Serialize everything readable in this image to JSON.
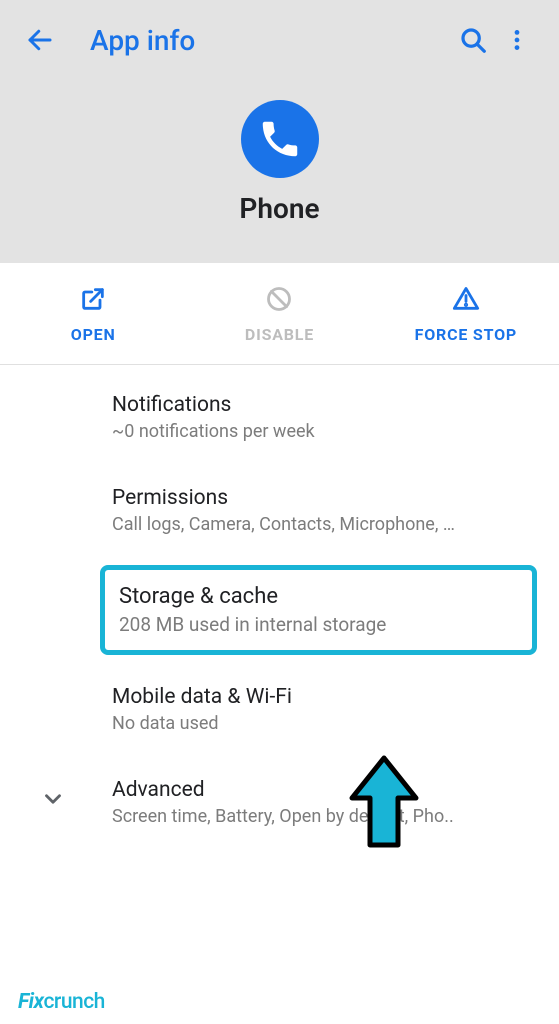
{
  "header": {
    "title": "App info"
  },
  "app": {
    "name": "Phone"
  },
  "actions": {
    "open": "OPEN",
    "disable": "DISABLE",
    "force_stop": "FORCE STOP"
  },
  "items": {
    "notifications": {
      "title": "Notifications",
      "sub": "~0 notifications per week"
    },
    "permissions": {
      "title": "Permissions",
      "sub": "Call logs, Camera, Contacts, Microphone, …"
    },
    "storage": {
      "title": "Storage & cache",
      "sub": "208 MB used in internal storage"
    },
    "mobile_data": {
      "title": "Mobile data & Wi-Fi",
      "sub": "No data used"
    },
    "advanced": {
      "title": "Advanced",
      "sub": "Screen time, Battery, Open by default, Pho.."
    }
  },
  "watermark": {
    "fix": "Fix",
    "crunch": "crunch"
  }
}
